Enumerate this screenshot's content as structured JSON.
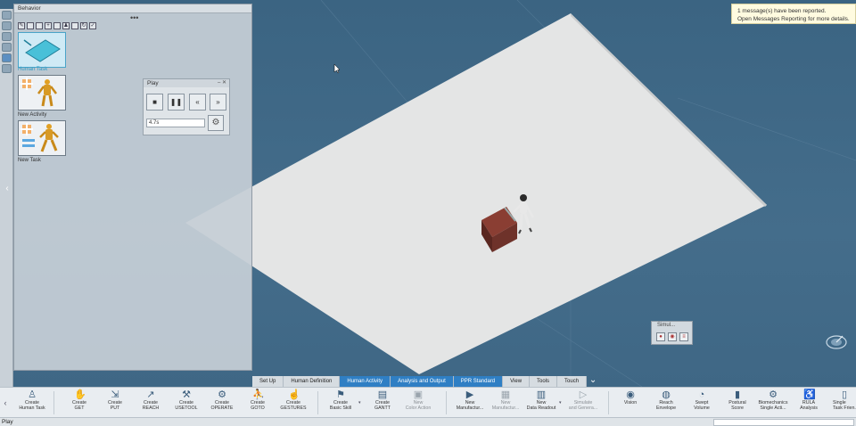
{
  "notification": {
    "line1": "1 message(s) have been reported.",
    "line2": "Open Messages Reporting for more details."
  },
  "behavior": {
    "title": "Behavior",
    "items": [
      {
        "label": "Human Task"
      },
      {
        "label": "New Activity"
      },
      {
        "label": "New Task"
      }
    ]
  },
  "play": {
    "title": "Play",
    "time_value": "4.7s"
  },
  "mini_panel": {
    "title": "Simul..."
  },
  "tabs": [
    {
      "label": "Set Up"
    },
    {
      "label": "Human Definition"
    },
    {
      "label": "Human Activity"
    },
    {
      "label": "Analysis and Output"
    },
    {
      "label": "PPR Standard"
    },
    {
      "label": "View"
    },
    {
      "label": "Tools"
    },
    {
      "label": "Touch"
    }
  ],
  "ribbon": [
    {
      "label": "Create\nHuman Task",
      "icon": "human-task-icon"
    },
    {
      "label": "Create\nGET",
      "icon": "get-icon"
    },
    {
      "label": "Create\nPUT",
      "icon": "put-icon"
    },
    {
      "label": "Create\nREACH",
      "icon": "reach-icon"
    },
    {
      "label": "Create\nUSETOOL",
      "icon": "usetool-icon"
    },
    {
      "label": "Create\nOPERATE",
      "icon": "operate-icon"
    },
    {
      "label": "Create\nGOTO",
      "icon": "goto-icon"
    },
    {
      "label": "Create\nGESTURES",
      "icon": "gestures-icon"
    },
    {
      "label": "Create\nBasic Skill",
      "icon": "basic-skill-icon"
    },
    {
      "label": "Create\nGANTT",
      "icon": "gantt-icon"
    },
    {
      "label": "New\nColor Action",
      "icon": "color-action-icon"
    },
    {
      "label": "New\nManufactur...",
      "icon": "manufacturing-icon"
    },
    {
      "label": "New\nManufactur...",
      "icon": "manufacturing2-icon"
    },
    {
      "label": "New\nData Readout",
      "icon": "data-readout-icon"
    },
    {
      "label": "Simulate\nand Genera...",
      "icon": "simulate-icon"
    },
    {
      "label": "Vision",
      "icon": "vision-icon"
    },
    {
      "label": "Reach\nEnvelope",
      "icon": "reach-envelope-icon"
    },
    {
      "label": "Swept\nVolume",
      "icon": "swept-volume-icon"
    },
    {
      "label": "Postural\nScore",
      "icon": "postural-score-icon"
    },
    {
      "label": "Biomechanics\nSingle Acti...",
      "icon": "biomechanics-icon"
    },
    {
      "label": "RULA\nAnalysis",
      "icon": "rula-icon"
    },
    {
      "label": "Single\nTask Frien...",
      "icon": "single-task-icon"
    }
  ],
  "status": {
    "text": "Play"
  }
}
